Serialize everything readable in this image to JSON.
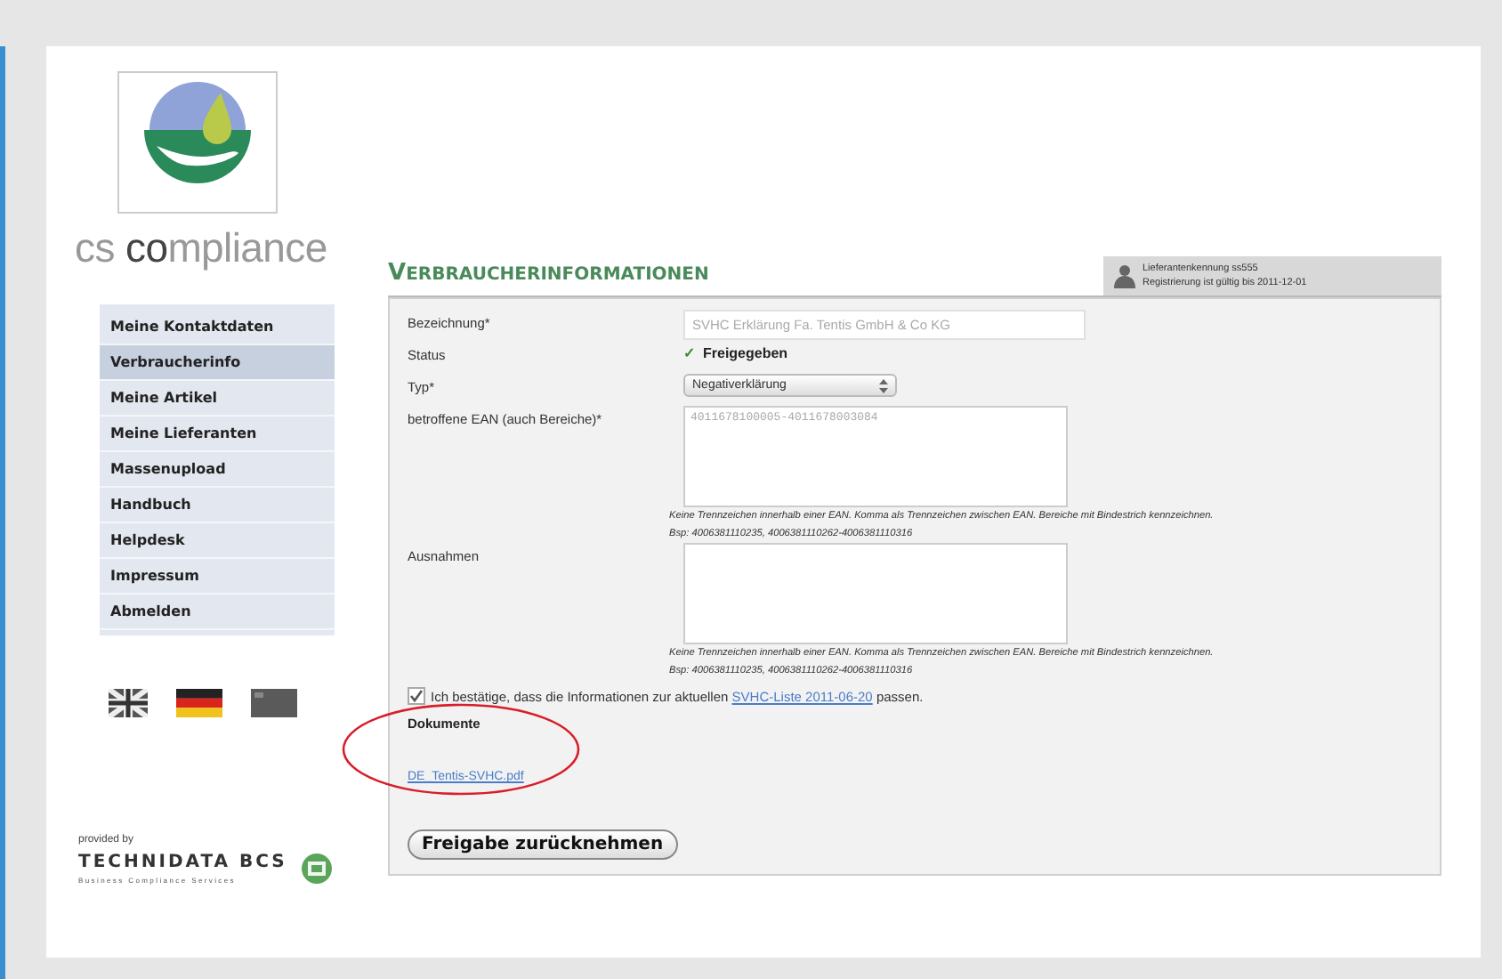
{
  "logo": {
    "text": "cs **co**mpliance"
  },
  "nav": [
    {
      "label": "Meine Kontaktdaten",
      "selected": false
    },
    {
      "label": "Verbraucherinfo",
      "selected": true
    },
    {
      "label": "Meine Artikel",
      "selected": false
    },
    {
      "label": "Meine Lieferanten",
      "selected": false
    },
    {
      "label": "Massenupload",
      "selected": false
    },
    {
      "label": "Handbuch",
      "selected": false
    },
    {
      "label": "Helpdesk",
      "selected": false
    },
    {
      "label": "Impressum",
      "selected": false
    },
    {
      "label": "Abmelden",
      "selected": false
    }
  ],
  "provider": {
    "caption": "provided by",
    "name": "TECHNIDATA BCS",
    "tagline": "Business Compliance Services"
  },
  "user": {
    "line_1": "Lieferantenkennung ss555",
    "line_2": "Registrierung ist gültig bis 2011-12-01"
  },
  "page_title": "VERBRAUCHERINFORMATIONEN",
  "form": {
    "name_label": "Bezeichnung*",
    "name_value": "SVHC Erklärung Fa. Tentis GmbH & Co KG",
    "status_label": "Status",
    "status_mark": "✓",
    "status_value": "Freigegeben",
    "type_label": "Typ*",
    "type_value": "Negativerklärung",
    "ean_label": "betroffene EAN (auch Bereiche)*",
    "ean_value": "4011678100005-4011678003084",
    "ean_hint_1": "Keine Trennzeichen innerhalb einer EAN. Komma als Trennzeichen zwischen EAN. Bereiche mit Bindestrich kennzeichnen.",
    "ean_hint_2": "Bsp: 4006381110235, 4006381110262-4006381110316",
    "exceptions_label": "Ausnahmen",
    "exceptions_hint_1": "Keine Trennzeichen innerhalb einer EAN. Komma als Trennzeichen zwischen EAN. Bereiche mit Bindestrich kennzeichnen.",
    "exceptions_hint_2": "Bsp: 4006381110235, 4006381110262-4006381110316",
    "confirm": {
      "checked": true,
      "before": "Ich bestätige, dass die Informationen zur aktuellen",
      "link": "SVHC-Liste 2011-06-20",
      "after": "passen."
    },
    "documents_label": "Dokumente",
    "document_link": "DE_Tentis-SVHC.pdf",
    "button": "Freigabe zurücknehmen"
  }
}
